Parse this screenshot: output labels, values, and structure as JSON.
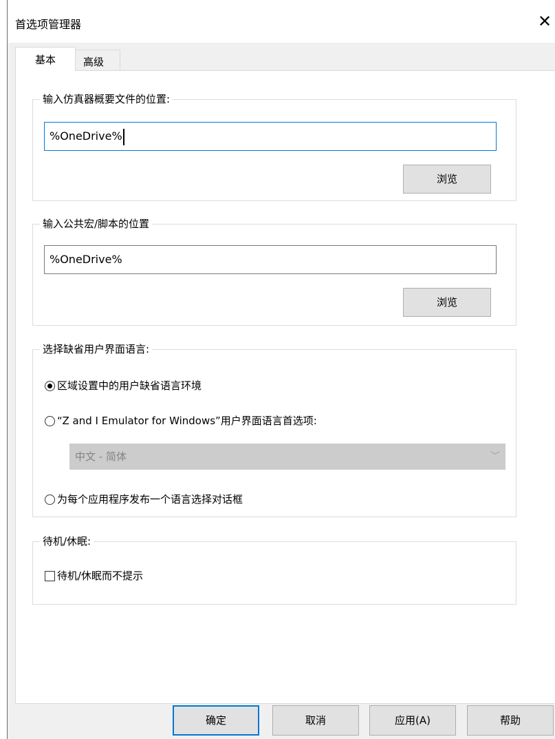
{
  "window": {
    "title": "首选项管理器"
  },
  "tabs": [
    {
      "label": "基本",
      "active": true
    },
    {
      "label": "高级",
      "active": false
    }
  ],
  "sim_profile": {
    "legend": "输入仿真器概要文件的位置:",
    "value": "%OneDrive%",
    "browse_label": "浏览"
  },
  "macro_path": {
    "legend": "输入公共宏/脚本的位置",
    "value": "%OneDrive%",
    "browse_label": "浏览"
  },
  "language": {
    "legend": "选择缺省用户界面语言:",
    "options": [
      {
        "label": "区域设置中的用户缺省语言环境",
        "selected": true
      },
      {
        "label": "“Z and I Emulator for Windows”用户界面语言首选项:",
        "selected": false
      },
      {
        "label": "为每个应用程序发布一个语言选择对话框",
        "selected": false
      }
    ],
    "dropdown_value": "中文 - 简体"
  },
  "standby": {
    "legend": "待机/休眠:",
    "checkbox_label": "待机/休眠而不提示",
    "checked": false
  },
  "footer": {
    "ok": "确定",
    "cancel": "取消",
    "apply": "应用(A)",
    "help": "帮助"
  }
}
